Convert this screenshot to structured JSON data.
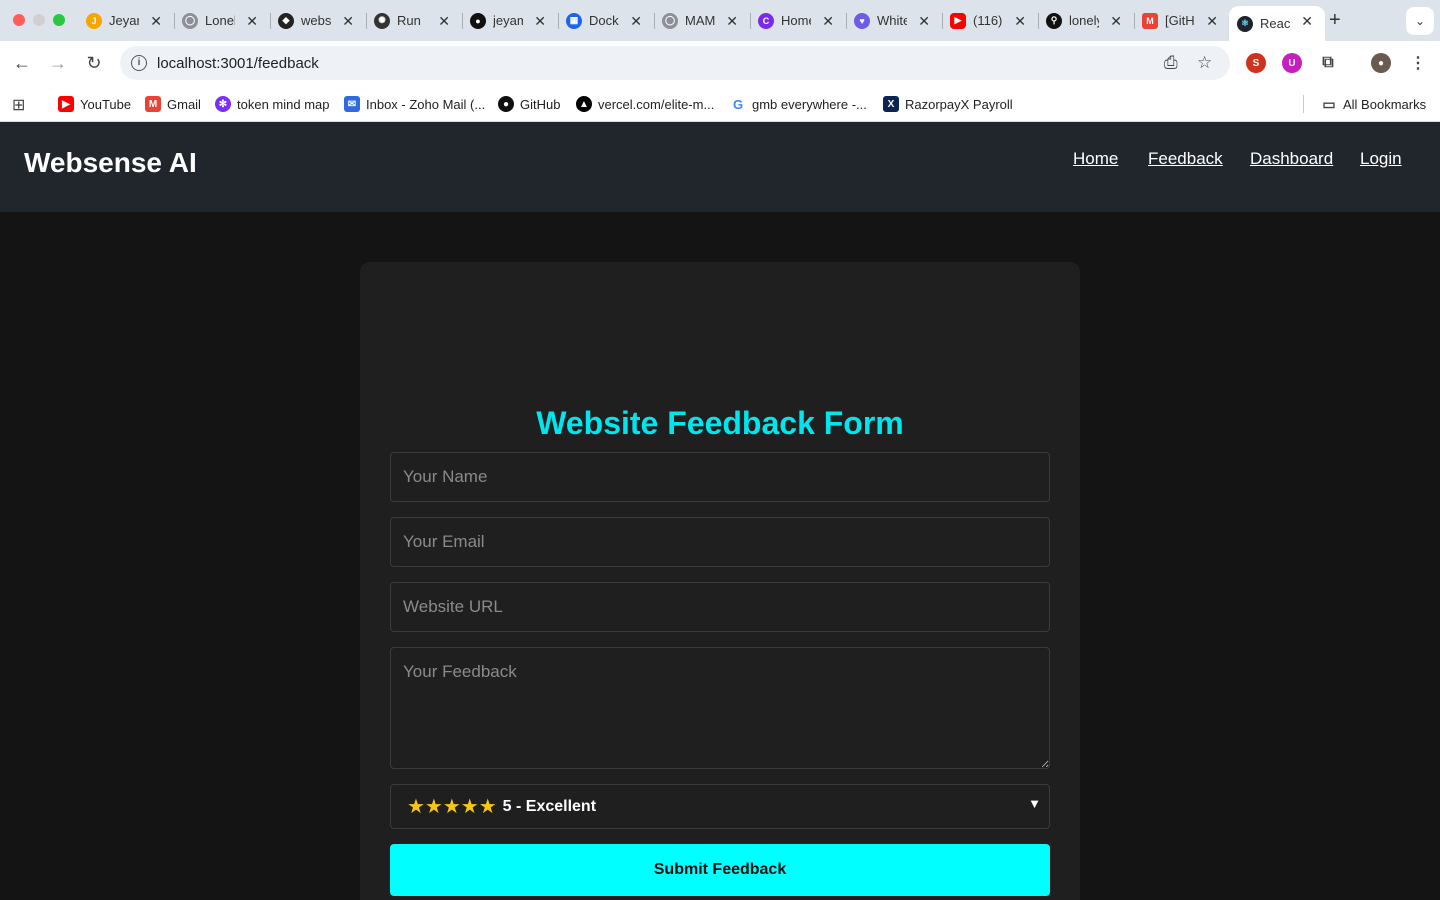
{
  "browser": {
    "tabs": [
      {
        "title": "Jeyam",
        "icon": "jb-icon",
        "color": "#f7a600"
      },
      {
        "title": "Lonely",
        "icon": "globe-icon",
        "color": "#8a8f98"
      },
      {
        "title": "websense",
        "icon": "app-icon",
        "color": "#222222"
      },
      {
        "title": "Run",
        "icon": "openai-icon",
        "color": "#333333"
      },
      {
        "title": "jeyam",
        "icon": "github-icon",
        "color": "#111111"
      },
      {
        "title": "Docker",
        "icon": "docker-icon",
        "color": "#1d63ed"
      },
      {
        "title": "MAMP",
        "icon": "globe-icon",
        "color": "#8a8f98"
      },
      {
        "title": "Home",
        "icon": "canva-icon",
        "color": "#7d2ae8"
      },
      {
        "title": "White",
        "icon": "heart-icon",
        "color": "#6c5ce7"
      },
      {
        "title": "(116)",
        "icon": "youtube-icon",
        "color": "#ff0000"
      },
      {
        "title": "lonely",
        "icon": "link-icon",
        "color": "#111111"
      },
      {
        "title": "[GitHub]",
        "icon": "gmail-icon",
        "color": "#ea4335"
      },
      {
        "title": "React App",
        "icon": "react-icon",
        "color": "#20232a"
      }
    ],
    "url": "localhost:3001/feedback",
    "bookmarks": [
      {
        "label": "YouTube",
        "icon": "youtube-icon",
        "color": "#ff0000"
      },
      {
        "label": "Gmail",
        "icon": "gmail-icon",
        "color": "#ea4335"
      },
      {
        "label": "token mind map",
        "icon": "mindmap-icon",
        "color": "#7b2ff7"
      },
      {
        "label": "Inbox - Zoho Mail (...",
        "icon": "zoho-mail-icon",
        "color": "#2d6ae3"
      },
      {
        "label": "GitHub",
        "icon": "github-icon",
        "color": "#111111"
      },
      {
        "label": "vercel.com/elite-m...",
        "icon": "vercel-icon",
        "color": "#000000"
      },
      {
        "label": "gmb everywhere -...",
        "icon": "google-icon",
        "color": "#4285f4"
      },
      {
        "label": "RazorpayX Payroll",
        "icon": "razorpay-icon",
        "color": "#0c2451"
      }
    ],
    "all_bookmarks": "All Bookmarks"
  },
  "site": {
    "brand": "Websense AI",
    "nav": [
      "Home",
      "Feedback",
      "Dashboard",
      "Login"
    ]
  },
  "form": {
    "title": "Website Feedback Form",
    "name_placeholder": "Your Name",
    "email_placeholder": "Your Email",
    "url_placeholder": "Website URL",
    "feedback_placeholder": "Your Feedback",
    "rating_stars": "★★★★★",
    "rating_label": "5 - Excellent",
    "submit_label": "Submit Feedback"
  },
  "colors": {
    "accent": "#00ffff",
    "title": "#00e6ef",
    "header_bg": "#21262d",
    "page_bg": "#141414",
    "card_bg": "#1f1f1f"
  }
}
